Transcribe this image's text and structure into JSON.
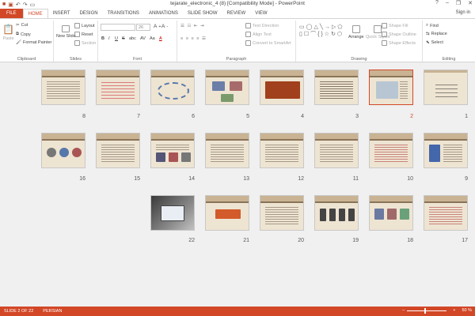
{
  "window": {
    "title": "tejarate_electronic_4 (8) [Compatibility Mode] - PowerPoint",
    "minimize": "–",
    "restore": "❐",
    "close": "✕",
    "help": "?"
  },
  "tabs": [
    {
      "label": "FILE"
    },
    {
      "label": "HOME"
    },
    {
      "label": "INSERT"
    },
    {
      "label": "DESIGN"
    },
    {
      "label": "TRANSITIONS"
    },
    {
      "label": "ANIMATIONS"
    },
    {
      "label": "SLIDE SHOW"
    },
    {
      "label": "REVIEW"
    },
    {
      "label": "VIEW"
    }
  ],
  "signin": "Sign in",
  "ribbon": {
    "clipboard": {
      "paste": "Paste",
      "cut": "Cut",
      "copy": "Copy",
      "format_painter": "Format Painter",
      "label": "Clipboard"
    },
    "slides": {
      "new_slide": "New Slide",
      "layout": "Layout",
      "reset": "Reset",
      "section": "Section",
      "label": "Slides"
    },
    "font": {
      "size": "26",
      "label": "Font",
      "bold": "B",
      "italic": "I",
      "underline": "U",
      "strike": "S",
      "shadow": "abc",
      "spacing": "AV",
      "case": "Aa",
      "color": "A"
    },
    "paragraph": {
      "text_direction": "Text Direction",
      "align_text": "Align Text",
      "smartart": "Convert to SmartArt",
      "label": "Paragraph"
    },
    "drawing": {
      "arrange": "Arrange",
      "quick_styles": "Quick Styles",
      "shape_fill": "Shape Fill",
      "shape_outline": "Shape Outline",
      "shape_effects": "Shape Effects",
      "label": "Drawing"
    },
    "editing": {
      "find": "Find",
      "replace": "Replace",
      "select": "Select",
      "label": "Editing"
    }
  },
  "slides": [
    {
      "n": "8"
    },
    {
      "n": "7"
    },
    {
      "n": "6"
    },
    {
      "n": "5"
    },
    {
      "n": "4"
    },
    {
      "n": "3"
    },
    {
      "n": "2"
    },
    {
      "n": "1"
    },
    {
      "n": "16"
    },
    {
      "n": "15"
    },
    {
      "n": "14"
    },
    {
      "n": "13"
    },
    {
      "n": "12"
    },
    {
      "n": "11"
    },
    {
      "n": "10"
    },
    {
      "n": "9"
    },
    {
      "n": "22"
    },
    {
      "n": "21"
    },
    {
      "n": "20"
    },
    {
      "n": "19"
    },
    {
      "n": "18"
    },
    {
      "n": "17"
    }
  ],
  "status": {
    "slide": "SLIDE 2 OF 22",
    "language": "PERSIAN",
    "zoom": "50 %",
    "zoom_minus": "–",
    "zoom_plus": "+"
  }
}
